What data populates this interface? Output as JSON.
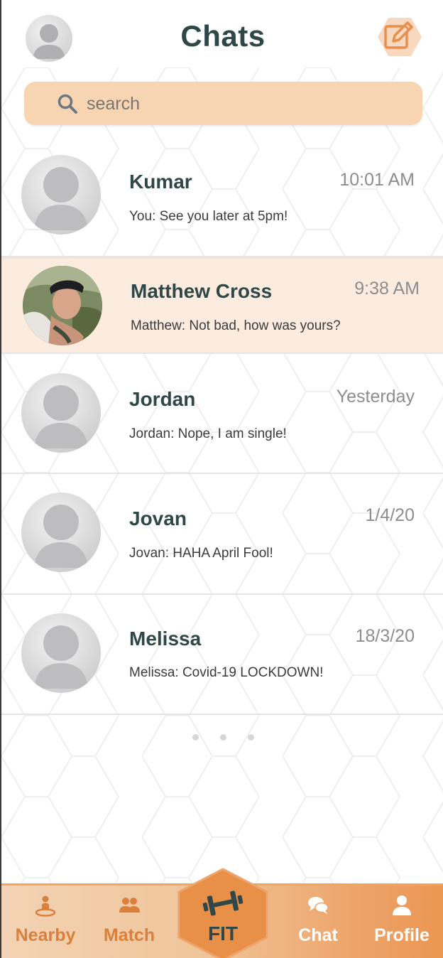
{
  "header": {
    "title": "Chats",
    "avatar_icon": "user-avatar-placeholder",
    "compose_icon": "edit-compose-icon"
  },
  "search": {
    "placeholder": "search",
    "value": ""
  },
  "chats": [
    {
      "name": "Kumar",
      "time": "10:01 AM",
      "message": "You: See you later at 5pm!",
      "avatar": "placeholder",
      "active": false
    },
    {
      "name": "Matthew Cross",
      "time": "9:38 AM",
      "message": "Matthew: Not bad, how was yours?",
      "avatar": "photo",
      "active": true
    },
    {
      "name": "Jordan",
      "time": "Yesterday",
      "message": "Jordan: Nope, I am single!",
      "avatar": "placeholder",
      "active": false
    },
    {
      "name": "Jovan",
      "time": "1/4/20",
      "message": "Jovan: HAHA April Fool!",
      "avatar": "placeholder",
      "active": false
    },
    {
      "name": "Melissa",
      "time": "18/3/20",
      "message": "Melissa: Covid-19 LOCKDOWN!",
      "avatar": "placeholder",
      "active": false
    }
  ],
  "pager": {
    "dots": 3
  },
  "nav": {
    "items": [
      {
        "label": "Nearby",
        "icon": "location-person-icon"
      },
      {
        "label": "Match",
        "icon": "users-icon"
      },
      {
        "label": "FIT",
        "icon": "dumbbell-icon"
      },
      {
        "label": "Chat",
        "icon": "chat-bubbles-icon"
      },
      {
        "label": "Profile",
        "icon": "profile-user-icon"
      }
    ]
  },
  "colors": {
    "accent": "#eb9652",
    "search_bg": "#f7d5b3",
    "active_row": "#fcecdf",
    "text_dark": "#2f4747",
    "nav_label_light": "#d9803c",
    "nav_label_white": "#ffffff"
  }
}
